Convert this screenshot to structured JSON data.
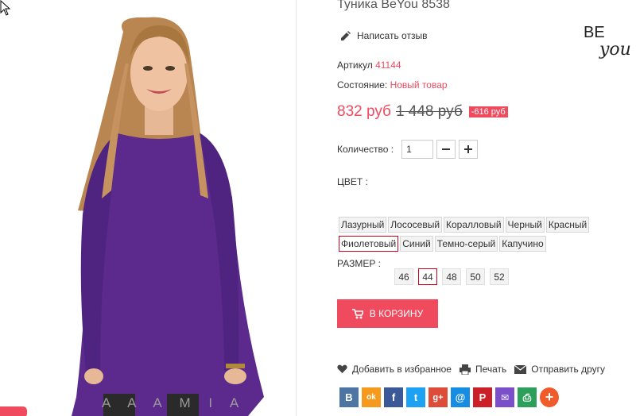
{
  "product": {
    "title": "Туника BeYou 8538",
    "review_label": "Написать отзыв",
    "article_label": "Артикул",
    "article_value": "41144",
    "condition_label": "Состояние:",
    "condition_value": "Новый товар",
    "price": "832 руб",
    "old_price": "1 448 руб",
    "discount": "-616 руб",
    "brand_logo": {
      "text_main": "BE",
      "text_script": "you"
    }
  },
  "image": {
    "watermark": "A  A  A  M  I  A"
  },
  "quantity": {
    "label": "Количество :",
    "value": "1",
    "minus_icon": "minus-icon",
    "plus_icon": "plus-icon"
  },
  "colors": {
    "label": "ЦВЕТ :",
    "row1": [
      "Лазурный",
      "Лососевый",
      "Коралловый",
      "Черный",
      "Красный"
    ],
    "row2": [
      "Фиолетовый",
      "Синий",
      "Темно-серый",
      "Капучино"
    ],
    "selected": "Фиолетовый"
  },
  "sizes": {
    "label": "РАЗМЕР :",
    "options": [
      "46",
      "44",
      "48",
      "50",
      "52"
    ],
    "selected": "44"
  },
  "cart": {
    "label": "В КОРЗИНУ"
  },
  "actions": {
    "favorite": "Добавить в избранное",
    "print": "Печать",
    "send": "Отправить другу"
  },
  "share": [
    {
      "icon": "vk-icon",
      "glyph": "B",
      "color": "#4c75a3"
    },
    {
      "icon": "odnoklassniki-icon",
      "glyph": "ok",
      "color": "#f59a1d"
    },
    {
      "icon": "facebook-icon",
      "glyph": "f",
      "color": "#3b5998"
    },
    {
      "icon": "twitter-icon",
      "glyph": "t",
      "color": "#1da1f2"
    },
    {
      "icon": "google-plus-icon",
      "glyph": "g+",
      "color": "#dd4b39"
    },
    {
      "icon": "mail-ru-icon",
      "glyph": "@",
      "color": "#168de2"
    },
    {
      "icon": "pinterest-icon",
      "glyph": "P",
      "color": "#cb2027"
    },
    {
      "icon": "email-icon",
      "glyph": "✉",
      "color": "#7b4fc9"
    },
    {
      "icon": "print-share-icon",
      "glyph": "⎙",
      "color": "#2ca05a"
    },
    {
      "icon": "more-share-icon",
      "glyph": "+",
      "color": "#f15a2b"
    }
  ],
  "theme": {
    "accent": "#f04a5e",
    "dress": "#5b2a8c"
  }
}
